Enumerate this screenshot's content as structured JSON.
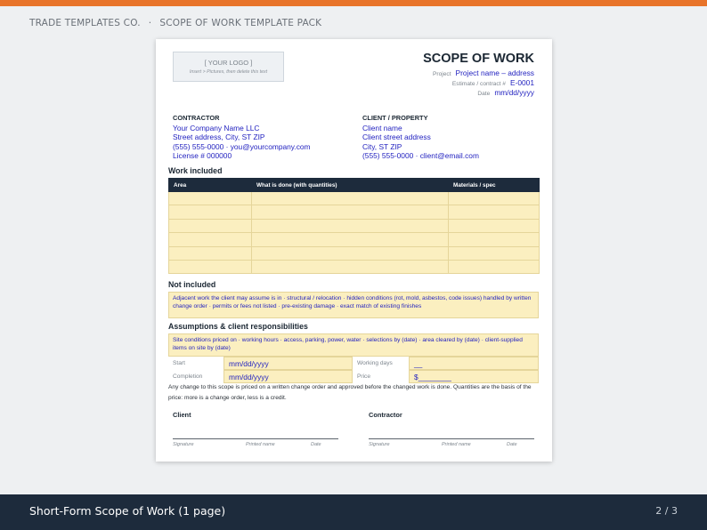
{
  "header": {
    "brand": "TRADE TEMPLATES CO.",
    "separator": "·",
    "pack": "SCOPE OF WORK TEMPLATE PACK"
  },
  "doc": {
    "logo_label": "[ YOUR LOGO ]",
    "logo_hint": "Insert > Pictures, then delete this text",
    "title": "SCOPE OF WORK",
    "project_label": "Project",
    "project_value": "Project name – address",
    "estimate_label": "Estimate / contract #",
    "estimate_value": "E-0001",
    "date_label": "Date",
    "date_value": "mm/dd/yyyy",
    "contractor": {
      "heading": "CONTRACTOR",
      "lines": [
        "Your Company Name LLC",
        "Street address, City, ST ZIP",
        "(555) 555-0000 · you@yourcompany.com",
        "License # 000000"
      ]
    },
    "client": {
      "heading": "CLIENT / PROPERTY",
      "lines": [
        "Client name",
        "Client street address",
        "City, ST ZIP",
        "(555) 555-0000 · client@email.com"
      ]
    },
    "work_included": {
      "heading": "Work included",
      "columns": [
        "Area",
        "What is done (with quantities)",
        "Materials / spec"
      ],
      "empty_rows": 6
    },
    "not_included": {
      "heading": "Not included",
      "text": "Adjacent work the client may assume is in · structural / relocation · hidden conditions (rot, mold, asbestos, code issues) handled by written change order · permits or fees not listed · pre-existing damage · exact match of existing finishes"
    },
    "assumptions": {
      "heading": "Assumptions & client responsibilities",
      "text": "Site conditions priced on · working hours · access, parking, power, water · selections by (date) · area cleared by (date) · client-supplied items on site by (date)"
    },
    "schedule": {
      "start_label": "Start",
      "start_value": "mm/dd/yyyy",
      "working_days_label": "Working days",
      "working_days_value": "__",
      "completion_label": "Completion",
      "completion_value": "mm/dd/yyyy",
      "price_label": "Price",
      "price_value": "$________"
    },
    "note": "Any change to this scope is priced on a written change order and approved before the changed work is done. Quantities are the basis of the price: more is a change order, less is a credit.",
    "signatures": {
      "client_heading": "Client",
      "contractor_heading": "Contractor",
      "signature_label": "Signature",
      "printed_name_label": "Printed name",
      "date_label": "Date"
    }
  },
  "footer": {
    "title": "Short-Form Scope of Work (1 page)",
    "page": "2 / 3"
  },
  "colors": {
    "accent": "#e8742a",
    "navy": "#1d2b3c",
    "field_fill": "#fbefc0",
    "field_text": "#1f1fbf"
  }
}
